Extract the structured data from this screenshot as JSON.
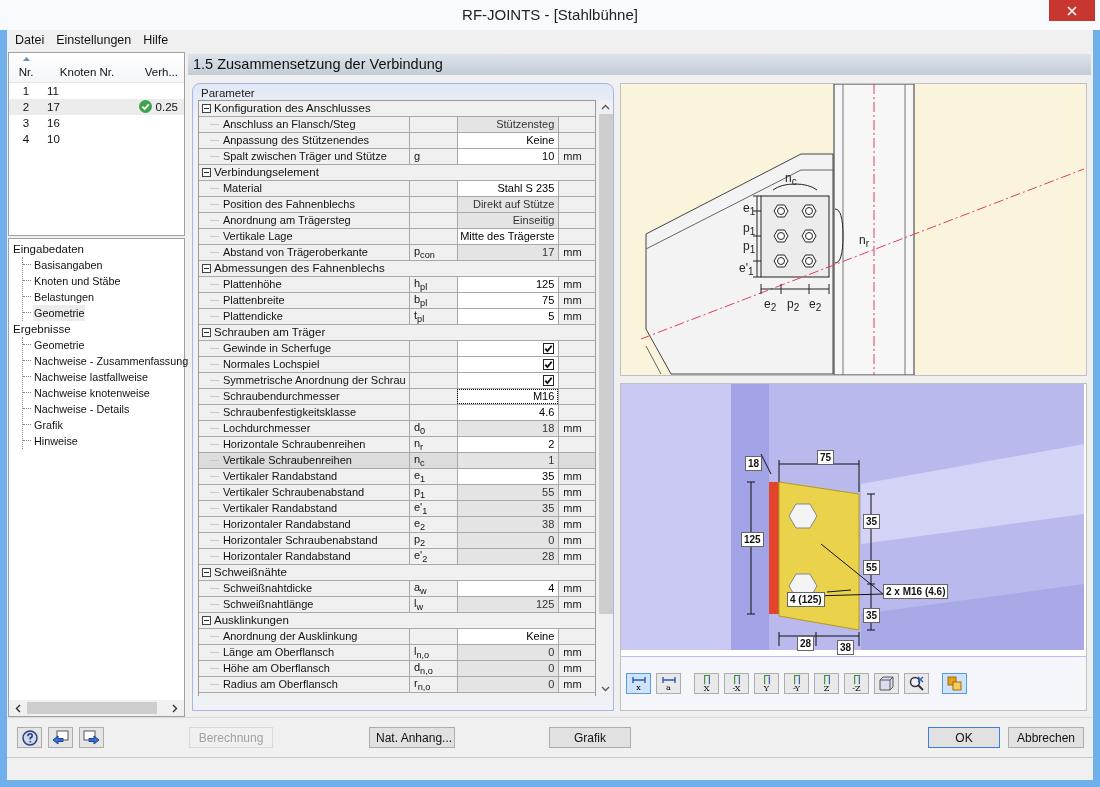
{
  "window": {
    "title": "RF-JOINTS - [Stahlbühne]"
  },
  "menu": [
    "Datei",
    "Einstellungen",
    "Hilfe"
  ],
  "nodes": {
    "columns": [
      "Nr.",
      "Knoten Nr.",
      "Verh..."
    ],
    "rows": [
      {
        "nr": "1",
        "node": "11",
        "selected": false,
        "ok": false
      },
      {
        "nr": "2",
        "node": "17",
        "ratio": "0.25",
        "selected": true,
        "ok": true
      },
      {
        "nr": "3",
        "node": "16",
        "selected": false,
        "ok": false
      },
      {
        "nr": "4",
        "node": "10",
        "selected": false,
        "ok": false
      }
    ]
  },
  "navigator": [
    {
      "label": "Eingabedaten",
      "children": [
        {
          "label": "Basisangaben",
          "selected": false
        },
        {
          "label": "Knoten und Stäbe",
          "selected": false
        },
        {
          "label": "Belastungen",
          "selected": false
        },
        {
          "label": "Geometrie",
          "selected": true
        }
      ]
    },
    {
      "label": "Ergebnisse",
      "children": [
        {
          "label": "Geometrie",
          "selected": false
        },
        {
          "label": "Nachweise - Zusammenfassung",
          "selected": false
        },
        {
          "label": "Nachweise lastfallweise",
          "selected": false
        },
        {
          "label": "Nachweise knotenweise",
          "selected": false
        },
        {
          "label": "Nachweise - Details",
          "selected": false
        },
        {
          "label": "Grafik",
          "selected": false
        },
        {
          "label": "Hinweise",
          "selected": false
        }
      ]
    }
  ],
  "section_title": "1.5 Zusammensetzung der Verbindung",
  "parameters": {
    "title": "Parameter",
    "groups": [
      {
        "label": "Konfiguration des Anschlusses",
        "expanded": true,
        "rows": [
          {
            "kind": "value",
            "label": "Anschluss an Flansch/Steg",
            "value": "Stützensteg",
            "editable": false,
            "selected": false,
            "focused": false
          },
          {
            "kind": "value",
            "label": "Anpassung des Stützenendes",
            "value": "Keine",
            "editable": true,
            "selected": false,
            "focused": false
          },
          {
            "kind": "value",
            "label": "Spalt zwischen Träger und Stütze",
            "symbol": "g",
            "value": "10",
            "unit": "mm",
            "editable": true,
            "selected": false,
            "focused": false
          }
        ]
      },
      {
        "label": "Verbindungselement",
        "expanded": true,
        "rows": [
          {
            "kind": "value",
            "label": "Material",
            "value": "Stahl S 235",
            "editable": true,
            "selected": false,
            "focused": false
          },
          {
            "kind": "value",
            "label": "Position des Fahnenblechs",
            "value": "Direkt auf Stütze",
            "editable": false,
            "selected": false,
            "focused": false
          },
          {
            "kind": "value",
            "label": "Anordnung am Trägersteg",
            "value": "Einseitig",
            "editable": false,
            "selected": false,
            "focused": false
          },
          {
            "kind": "value",
            "label": "Vertikale Lage",
            "value": "Mitte des Trägerste",
            "editable": true,
            "selected": false,
            "focused": false
          },
          {
            "kind": "value",
            "label": "Abstand von Trägeroberkante",
            "symbol": "p$_{con}$",
            "value": "17",
            "unit": "mm",
            "editable": false,
            "selected": false,
            "focused": false
          }
        ]
      },
      {
        "label": "Abmessungen des Fahnenblechs",
        "expanded": true,
        "rows": [
          {
            "kind": "value",
            "label": "Plattenhöhe",
            "symbol": "h$_{pl}$",
            "value": "125",
            "unit": "mm",
            "editable": true,
            "selected": false,
            "focused": false
          },
          {
            "kind": "value",
            "label": "Plattenbreite",
            "symbol": "b$_{pl}$",
            "value": "75",
            "unit": "mm",
            "editable": true,
            "selected": false,
            "focused": false
          },
          {
            "kind": "value",
            "label": "Plattendicke",
            "symbol": "t$_{pl}$",
            "value": "5",
            "unit": "mm",
            "editable": true,
            "selected": false,
            "focused": false
          }
        ]
      },
      {
        "label": "Schrauben am Träger",
        "expanded": true,
        "rows": [
          {
            "kind": "checkbox",
            "label": "Gewinde in Scherfuge",
            "checked": true,
            "editable": true,
            "selected": false,
            "focused": false
          },
          {
            "kind": "checkbox",
            "label": "Normales Lochspiel",
            "checked": true,
            "editable": true,
            "selected": false,
            "focused": false
          },
          {
            "kind": "checkbox",
            "label": "Symmetrische Anordnung der Schrau",
            "checked": true,
            "editable": true,
            "selected": false,
            "focused": false
          },
          {
            "kind": "value",
            "label": "Schraubendurchmesser",
            "value": "M16",
            "editable": true,
            "selected": false,
            "focused": true
          },
          {
            "kind": "value",
            "label": "Schraubenfestigkeitsklasse",
            "value": "4.6",
            "editable": true,
            "selected": false,
            "focused": false
          },
          {
            "kind": "value",
            "label": "Lochdurchmesser",
            "symbol": "d$_{0}$",
            "value": "18",
            "unit": "mm",
            "editable": false,
            "selected": false,
            "focused": false
          },
          {
            "kind": "value",
            "label": "Horizontale Schraubenreihen",
            "symbol": "n$_{r}$",
            "value": "2",
            "editable": true,
            "selected": false,
            "focused": false
          },
          {
            "kind": "value",
            "label": "Vertikale Schraubenreihen",
            "symbol": "n$_{c}$",
            "value": "1",
            "editable": false,
            "selected": true,
            "focused": false
          },
          {
            "kind": "value",
            "label": "Vertikaler Randabstand",
            "symbol": "e$_{1}$",
            "value": "35",
            "unit": "mm",
            "editable": true,
            "selected": false,
            "focused": false
          },
          {
            "kind": "value",
            "label": "Vertikaler Schraubenabstand",
            "symbol": "p$_{1}$",
            "value": "55",
            "unit": "mm",
            "editable": false,
            "selected": false,
            "focused": false
          },
          {
            "kind": "value",
            "label": "Vertikaler Randabstand",
            "symbol": "e'$_{1}$",
            "value": "35",
            "unit": "mm",
            "editable": false,
            "selected": false,
            "focused": false
          },
          {
            "kind": "value",
            "label": "Horizontaler Randabstand",
            "symbol": "e$_{2}$",
            "value": "38",
            "unit": "mm",
            "editable": false,
            "selected": false,
            "focused": false
          },
          {
            "kind": "value",
            "label": "Horizontaler Schraubenabstand",
            "symbol": "p$_{2}$",
            "value": "0",
            "unit": "mm",
            "editable": false,
            "selected": false,
            "focused": false
          },
          {
            "kind": "value",
            "label": "Horizontaler Randabstand",
            "symbol": "e'$_{2}$",
            "value": "28",
            "unit": "mm",
            "editable": false,
            "selected": false,
            "focused": false
          }
        ]
      },
      {
        "label": "Schweißnähte",
        "expanded": true,
        "rows": [
          {
            "kind": "value",
            "label": "Schweißnahtdicke",
            "symbol": "a$_{w}$",
            "value": "4",
            "unit": "mm",
            "editable": true,
            "selected": false,
            "focused": false
          },
          {
            "kind": "value",
            "label": "Schweißnahtlänge",
            "symbol": "l$_{w}$",
            "value": "125",
            "unit": "mm",
            "editable": false,
            "selected": false,
            "focused": false
          }
        ]
      },
      {
        "label": "Ausklinkungen",
        "expanded": true,
        "rows": [
          {
            "kind": "value",
            "label": "Anordnung der Ausklinkung",
            "value": "Keine",
            "editable": true,
            "selected": false,
            "focused": false
          },
          {
            "kind": "value",
            "label": "Länge am Oberflansch",
            "symbol": "l$_{n,o}$",
            "value": "0",
            "unit": "mm",
            "editable": false,
            "selected": false,
            "focused": false
          },
          {
            "kind": "value",
            "label": "Höhe am Oberflansch",
            "symbol": "d$_{n,o}$",
            "value": "0",
            "unit": "mm",
            "editable": false,
            "selected": false,
            "focused": false
          },
          {
            "kind": "value",
            "label": "Radius am Oberflansch",
            "symbol": "r$_{n,o}$",
            "value": "0",
            "unit": "mm",
            "editable": false,
            "selected": false,
            "focused": false
          }
        ]
      }
    ]
  },
  "schematic_labels": [
    "n$_{c}$",
    "e$_{1}$",
    "p$_{1}$",
    "p$_{1}$",
    "e'$_{1}$",
    "n$_{r}$",
    "e$_{2}$",
    "p$_{2}$",
    "e$_{2}$"
  ],
  "view_labels": [
    "18",
    "75",
    "125",
    "35",
    "55",
    "35",
    "4 (125)",
    "2 x M16 (4.6)",
    "28",
    "38"
  ],
  "view_toolbar": [
    {
      "kind": "dimension",
      "label": "x",
      "selected": true
    },
    {
      "kind": "dimension",
      "label": "a",
      "selected": false
    },
    {
      "kind": "axis",
      "label": "X",
      "selected": false
    },
    {
      "kind": "axis",
      "label": "-X",
      "selected": false
    },
    {
      "kind": "axis",
      "label": "Y",
      "selected": false
    },
    {
      "kind": "axis",
      "label": "-Y",
      "selected": false
    },
    {
      "kind": "axis",
      "label": "Z",
      "selected": false
    },
    {
      "kind": "axis",
      "label": "-Z",
      "selected": false
    },
    {
      "kind": "cube",
      "selected": false
    },
    {
      "kind": "zoom",
      "selected": false
    },
    {
      "kind": "layers",
      "selected": true
    }
  ],
  "footer": {
    "icon_buttons": [
      {
        "kind": "help"
      },
      {
        "kind": "back"
      },
      {
        "kind": "forward"
      }
    ],
    "buttons": [
      {
        "label": "Berechnung",
        "disabled": true,
        "default": false
      },
      {
        "label": "Nat. Anhang...",
        "disabled": false,
        "default": false
      },
      {
        "label": "Grafik",
        "disabled": false,
        "default": false
      },
      {
        "label": "OK",
        "disabled": false,
        "default": true
      },
      {
        "label": "Abbrechen",
        "disabled": false,
        "default": false
      }
    ]
  }
}
